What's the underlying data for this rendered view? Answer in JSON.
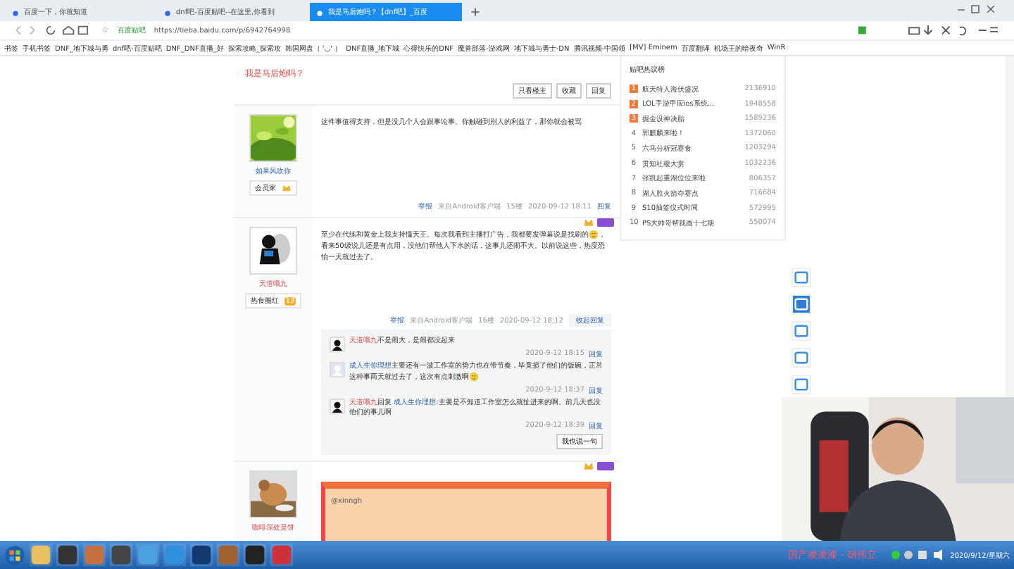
{
  "browser": {
    "tabs": [
      {
        "title": "百度一下，你就知道",
        "selected": false
      },
      {
        "title": "dnf吧-百度贴吧--在这里,你看到",
        "selected": false
      },
      {
        "title": "我是马后炮吗？【dnf吧】_百度",
        "selected": true
      }
    ],
    "address": {
      "star": "☆",
      "site_label": "百度贴吧",
      "url": "https://tieba.baidu.com/p/6942764998"
    },
    "bookmarks": [
      "书签",
      "手机书签",
      "DNF_地下城与勇",
      "dnf吧-百度贴吧",
      "DNF_DNF直播_好",
      "探索攻略_探索攻",
      "韩国网盘（ '◡' ）",
      "DNF直播_地下城",
      "心得快乐的DNF",
      "魔兽部落-游戏网",
      "地下城与勇士-DN",
      "腾讯视频-中国领",
      "[MV] Eminem",
      "百度翻译",
      "机场王的暗夜奇",
      "WinR"
    ]
  },
  "thread": {
    "title": "我是马后炮吗？",
    "actions": [
      "只看楼主",
      "收藏",
      "回复"
    ],
    "posts": [
      {
        "author": "如果风吹你",
        "badge": "会员家",
        "text": [
          "这件事值得支持，但是没几个人会跟事论事。你触碰到别人的利益了，那你就会被骂"
        ],
        "footer": {
          "report": "举报",
          "source": "来自Android客户端",
          "floor": "15楼",
          "time": "2020-09-12 18:11",
          "reply": "回复"
        }
      },
      {
        "author": "天道哦九",
        "badge": "热食圈红",
        "badge_level": "13",
        "text": [
          "至少在代练和黄金上我支持懂天王。每次我看到主播打广告，我都要发弹幕说是找刷的",
          "，看来50级说儿还是有点用，没他们帮他人下水的话，这事儿还闹不大。以前说这些，热度恐怕一天就过去了。"
        ],
        "footer": {
          "report": "举报",
          "source": "来自Android客户端",
          "floor": "16楼",
          "time": "2020-09-12 18:12",
          "reply": "收起回复"
        },
        "replies": [
          {
            "author": "天道哦九",
            "text": "不是闹大，是闹都没起来",
            "emoji": false,
            "time": "2020-9-12 18:15",
            "reply": "回复"
          },
          {
            "author": "成人生你理想",
            "text": "主要还有一波工作室的势力也在带节奏，毕竟损了他们的饭碗，正常这种事两天就过去了，这次有点刺激啊",
            "emoji": true,
            "time": "2020-9-12 18:37",
            "reply": "回复"
          },
          {
            "author": "天道哦九",
            "reply_to": "成人生你理想",
            "reply_word": "回复",
            "text": ":主要是不知道工作室怎么就扯进来的啊。前几天也没他们的事儿啊",
            "emoji": false,
            "time": "2020-9-12 18:39",
            "reply": "回复"
          }
        ],
        "reply_button": "我也说一句"
      },
      {
        "author": "咖啡深处是饼",
        "mention": "@xinngh"
      }
    ]
  },
  "hot_list": {
    "title": "贴吧热议榜",
    "items": [
      {
        "rank": "1",
        "title": "航天特人海伏盛况",
        "count": "2136910",
        "highlighted": true
      },
      {
        "rank": "2",
        "title": "LOL手游甲应ios系统...",
        "count": "1948558",
        "highlighted": true
      },
      {
        "rank": "3",
        "title": "掘金设神决胎",
        "count": "1589236",
        "highlighted": true
      },
      {
        "rank": "4",
        "title": "郭麒麟来啦！",
        "count": "1372060",
        "highlighted": false
      },
      {
        "rank": "5",
        "title": "六马分析冠赛食",
        "count": "1203294",
        "highlighted": false
      },
      {
        "rank": "6",
        "title": "贯知社稷大赏",
        "count": "1032236",
        "highlighted": false
      },
      {
        "rank": "7",
        "title": "张凯起重湖位位来啦",
        "count": "806357",
        "highlighted": false
      },
      {
        "rank": "8",
        "title": "湖人胜火箭夺赛点",
        "count": "716684",
        "highlighted": false
      },
      {
        "rank": "9",
        "title": "S10抽签仪式时间",
        "count": "572995",
        "highlighted": false
      },
      {
        "rank": "10",
        "title": "PS大帅哥帮我画十七期",
        "count": "550074",
        "highlighted": false
      }
    ]
  },
  "taskbar": {
    "now_playing": "国产凌凌漆 - 胡伟立",
    "date": "2020/9/12/星期六"
  }
}
